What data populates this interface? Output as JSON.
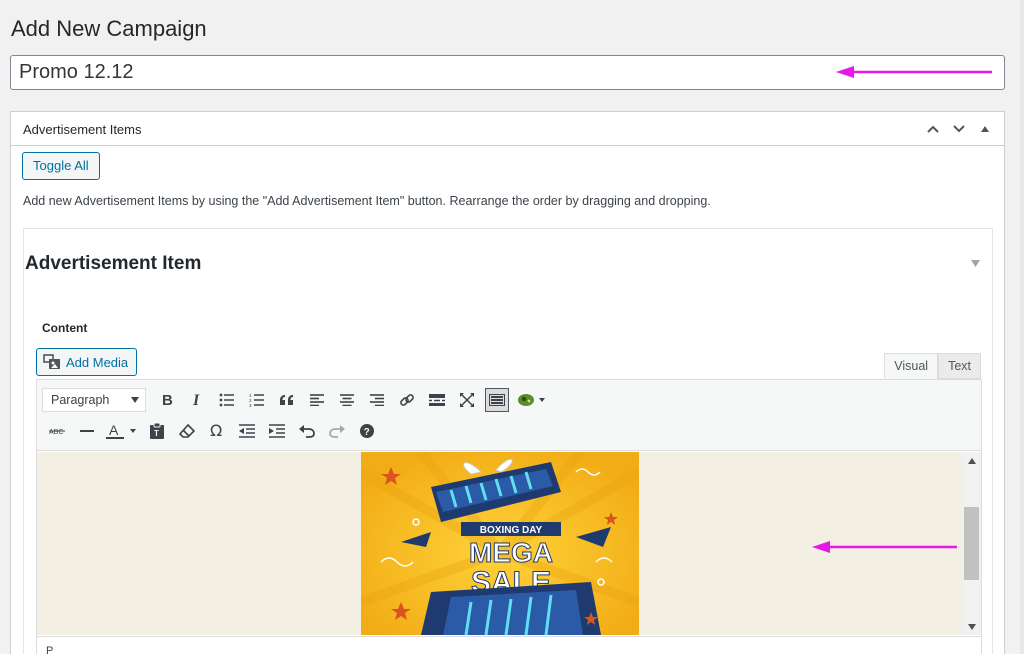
{
  "page": {
    "title": "Add New Campaign"
  },
  "campaign": {
    "title_value": "Promo 12.12"
  },
  "metabox": {
    "title": "Advertisement Items",
    "toggle_all_label": "Toggle All",
    "help_text": "Add new Advertisement Items by using the \"Add Advertisement Item\" button. Rearrange the order by dragging and dropping."
  },
  "item": {
    "title": "Advertisement Item",
    "content_label": "Content",
    "add_media_label": "Add Media"
  },
  "editor": {
    "tabs": {
      "visual": "Visual",
      "text": "Text"
    },
    "format_value": "Paragraph",
    "path": "P",
    "image_text": {
      "line1": "BOXING DAY",
      "line2": "MEGA",
      "line3": "SALE"
    }
  },
  "colors": {
    "accent": "#0071a1",
    "arrow": "#e619e6",
    "image_bg": "#f5b91f"
  }
}
